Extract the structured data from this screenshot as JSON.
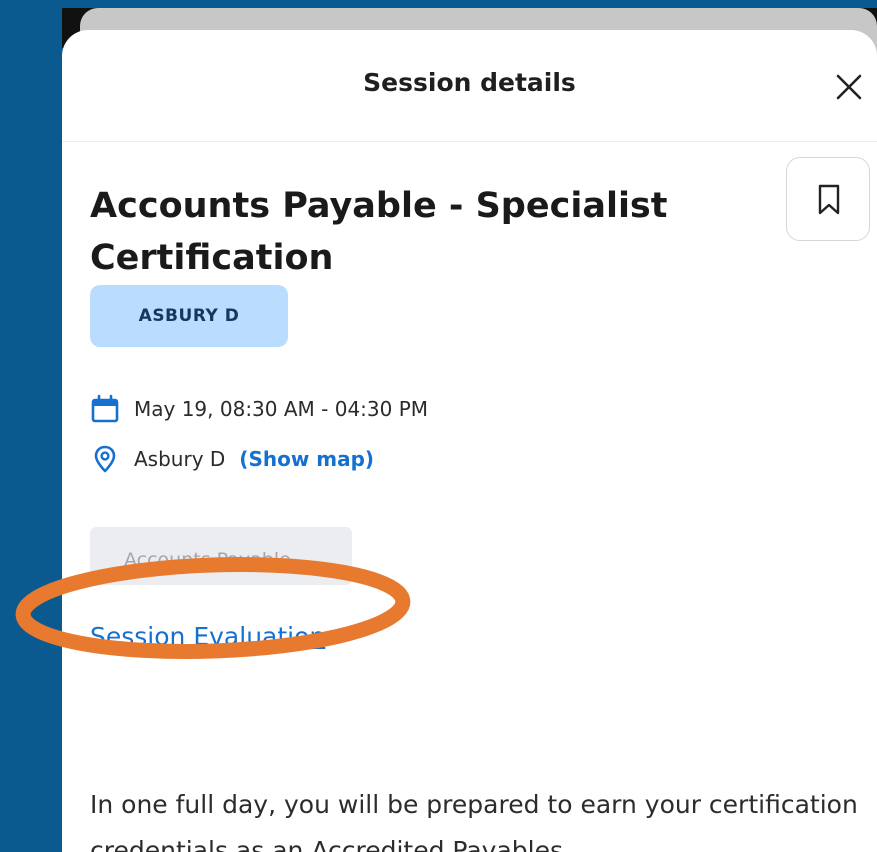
{
  "header": {
    "title": "Session details",
    "close_icon": "close-icon"
  },
  "session": {
    "title": "Accounts Payable - Specialist Certification",
    "bookmark_icon": "bookmark-icon",
    "track_chip": "ASBURY D",
    "date_icon": "calendar-icon",
    "datetime": "May 19, 08:30 AM - 04:30 PM",
    "location_icon": "location-pin-icon",
    "location": "Asbury D",
    "show_map": "(Show map)",
    "tag": "Accounts Payable",
    "evaluation_link": "Session Evaluation",
    "description": "In one full day, you will be prepared to earn your certification credentials as an Accredited Payables"
  },
  "colors": {
    "background": "#0b5a8f",
    "accent_blue": "#1670cf",
    "chip_blue": "#b9dcff",
    "annotation_orange": "#e87a30"
  }
}
